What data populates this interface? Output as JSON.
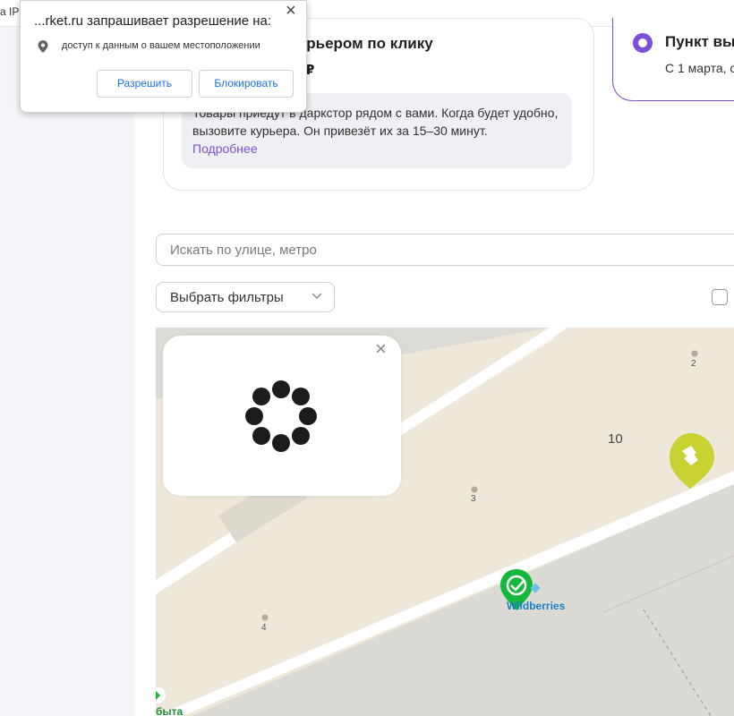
{
  "browser": {
    "tab_text": "а IP"
  },
  "delivery_card": {
    "title": "урьером по клику",
    "price": "₽",
    "info_text": "Товары приедут в даркстор рядом с вами. Когда будет удобно, вызовите курьера. Он привезёт их за 15–30 минут.",
    "more_link": "Подробнее"
  },
  "pickup_option": {
    "title": "Пункт вы",
    "subtitle": "С 1 марта, с"
  },
  "search": {
    "placeholder": "Искать по улице, метро"
  },
  "filters": {
    "label": "Выбрать фильтры"
  },
  "map": {
    "labels": {
      "house_2": "2",
      "house_3": "3",
      "house_4": "4",
      "house_10": "10"
    },
    "poi_wildberries": "Wildberries",
    "poi_bottom": "быта",
    "colors": {
      "land": "#ede8d9",
      "building": "#dddbd5",
      "road": "#ffffff",
      "pin_yellow": "#c8d232",
      "pin_green": "#14b83c"
    }
  },
  "loader": {
    "close_icon": "×"
  },
  "permission_popup": {
    "title": "...rket.ru запрашивает разрешение на:",
    "permission_text": "доступ к данным о вашем местоположении",
    "allow_label": "Разрешить",
    "block_label": "Блокировать",
    "close_icon": "×"
  },
  "colors": {
    "accent": "#7b4fd6",
    "link": "#1a73e8"
  }
}
